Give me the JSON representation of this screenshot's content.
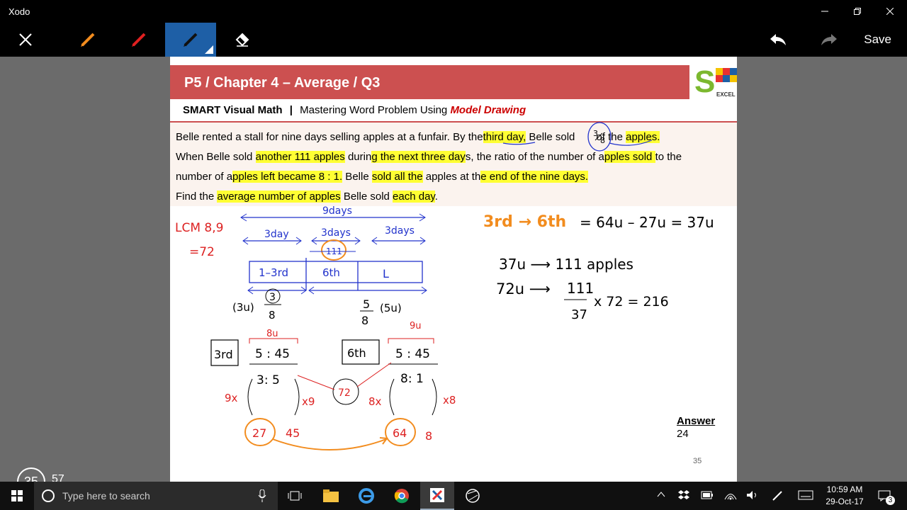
{
  "window": {
    "title": "Xodo"
  },
  "toolbar": {
    "save_label": "Save"
  },
  "document": {
    "header_title": "P5 / Chapter 4 – Average / Q3",
    "logo": {
      "letters": "SMARTEXCEL"
    },
    "subheader": {
      "brand": "SMART Visual Math",
      "separator": "|",
      "middle": "Mastering Word Problem Using",
      "emphasis": "Model Drawing"
    },
    "question": {
      "l1_a": "Belle rented a stall for nine days selling apples at a funfair. By the",
      "l1_b": "third day,",
      "l1_c": " Belle sold",
      "l1_d": "of the",
      "l1_e": "apples.",
      "l2_a": "When Belle sold ",
      "l2_b": "another 111 apples",
      "l2_c": " durin",
      "l2_d": "g the next three day",
      "l2_e": "s, the ratio of the number of a",
      "l2_f": "pples sold ",
      "l2_g": "to the",
      "l3_a": "number of a",
      "l3_b": "pples left became 8 : 1.",
      "l3_c": " Belle ",
      "l3_d": "sold all the",
      "l3_e": " apples at th",
      "l3_f": "e end of the nine days.",
      "l4_a": "Find the ",
      "l4_b": "average number of apples",
      "l4_c": " Belle sold ",
      "l4_d": "each day",
      "l4_e": "."
    },
    "answer_label": "Answer",
    "answer_value": "24",
    "page_number": "35"
  },
  "annotations": {
    "frac_num": "3",
    "frac_den": "8",
    "lcm1": "LCM 8,9",
    "lcm2": "=72",
    "nine_days": "9days",
    "day3a": "3day",
    "day3b": "3days",
    "day3c": "3days",
    "box1": "1–3rd",
    "box2": "6th",
    "box3": "L",
    "circ111": "111",
    "u3": "(3u)",
    "f3": "3",
    "f8": "8",
    "f5": "5",
    "f8b": "8",
    "u5": "(5u)",
    "lab3rd": "3rd",
    "lab6th": "6th",
    "r1": "5 : 45",
    "r2": "5 : 45",
    "u8": "8u",
    "u9": "9u",
    "r35": "3: 5",
    "r81": "8: 1",
    "c72": "72",
    "x9a": "9x",
    "x9b": "x9",
    "x8a": "8x",
    "x8b": "x8",
    "c27": "27",
    "n45": "45",
    "c64": "64",
    "n8": "8",
    "eq1a": "3rd → 6th",
    "eq1b": "= 64u – 27u = 37u",
    "eq2": "37u ⟶ 111 apples",
    "eq3a": "72u ⟶",
    "eq3n": "111",
    "eq3d": "37",
    "eq3b": "x 72 = 216"
  },
  "viewer": {
    "current_page": "35",
    "total_pages": "57"
  },
  "taskbar": {
    "search_placeholder": "Type here to search",
    "time": "10:59 AM",
    "date": "29-Oct-17",
    "notification_count": "3"
  },
  "colors": {
    "accent": "#1e5fa6",
    "header": "#cc5050",
    "highlight": "#ffff33",
    "ink_blue": "#2233cc",
    "ink_red": "#dd2222",
    "ink_orange": "#f28c1e"
  }
}
